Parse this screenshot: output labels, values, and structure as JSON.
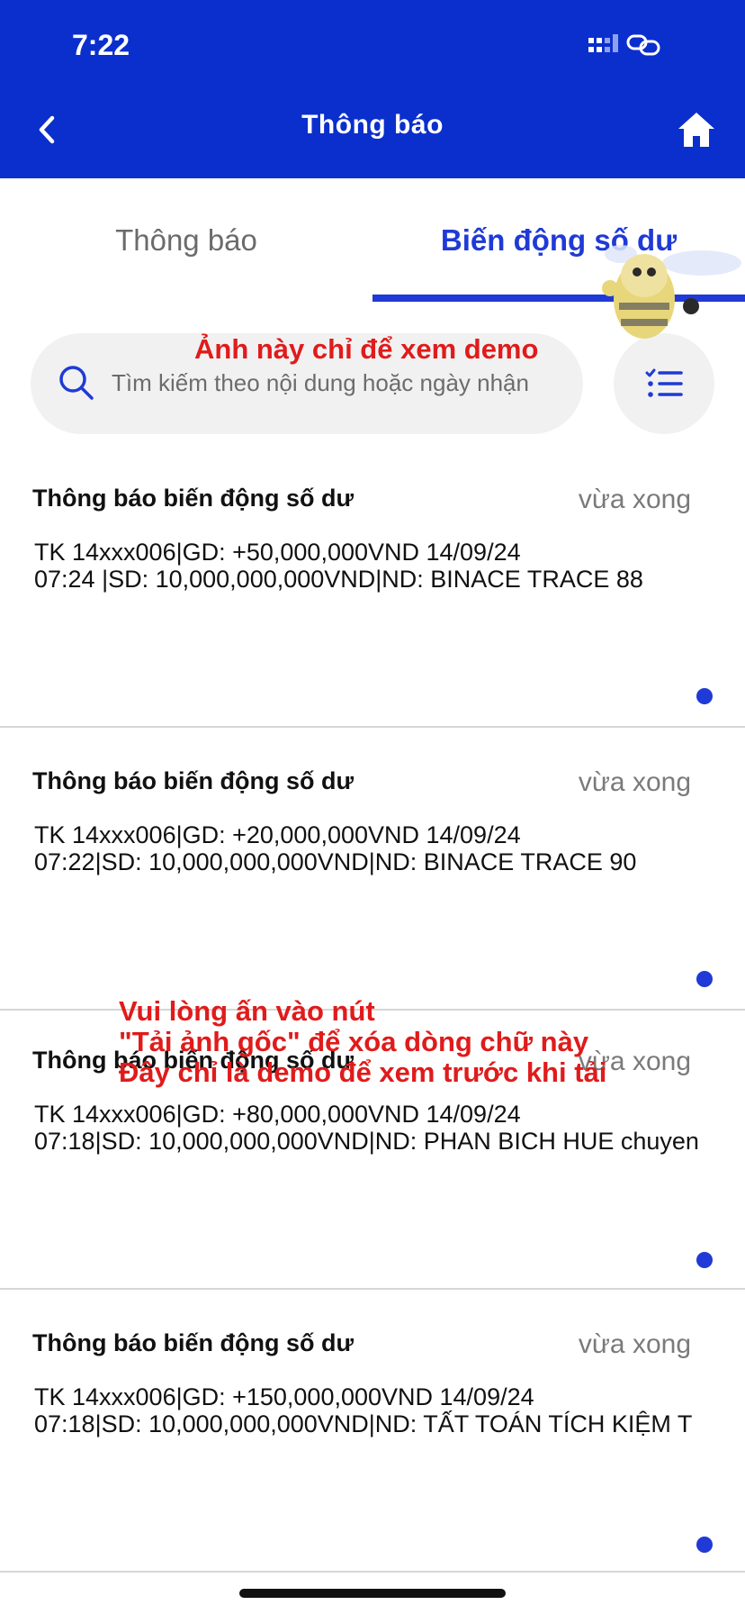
{
  "status_bar": {
    "time": "7:22"
  },
  "header": {
    "title": "Thông báo"
  },
  "tabs": [
    {
      "label": "Thông báo",
      "active": false
    },
    {
      "label": "Biến động số dư",
      "active": true
    }
  ],
  "search": {
    "placeholder": "Tìm kiếm theo nội dung hoặc ngày nhận"
  },
  "watermarks": {
    "top": "Ảnh này chỉ để xem demo",
    "middle_line1": "Vui lòng ấn vào nút",
    "middle_line2": "\"Tải ảnh gốc\" để xóa dòng chữ này",
    "middle_line3": "Đây chỉ là demo để xem trước khi tải"
  },
  "notifications": [
    {
      "title": "Thông báo biến động số dư",
      "time": "vừa xong",
      "body": "TK 14xxx006|GD: +50,000,000VND 14/09/24\n07:24 |SD: 10,000,000,000VND|ND: BINACE TRACE 88",
      "unread": true
    },
    {
      "title": "Thông báo biến động số dư",
      "time": "vừa xong",
      "body": "TK 14xxx006|GD: +20,000,000VND 14/09/24\n07:22|SD: 10,000,000,000VND|ND: BINACE TRACE 90",
      "unread": true
    },
    {
      "title": "Thông báo biến động số dư",
      "time": "vừa xong",
      "body": "TK 14xxx006|GD: +80,000,000VND 14/09/24\n07:18|SD: 10,000,000,000VND|ND: PHAN BICH HUE chuyen",
      "unread": true
    },
    {
      "title": "Thông báo biến động số dư",
      "time": "vừa xong",
      "body": "TK 14xxx006|GD: +150,000,000VND 14/09/24\n07:18|SD: 10,000,000,000VND|ND: TẤT TOÁN TÍCH KIỆM T",
      "unread": true
    }
  ],
  "colors": {
    "header_bg": "#0b2fcc",
    "accent": "#1f3ad6",
    "watermark": "#e01b1b"
  },
  "icons": [
    "signal-icon",
    "link-icon",
    "back-icon",
    "home-icon",
    "search-icon",
    "filter-list-icon"
  ]
}
